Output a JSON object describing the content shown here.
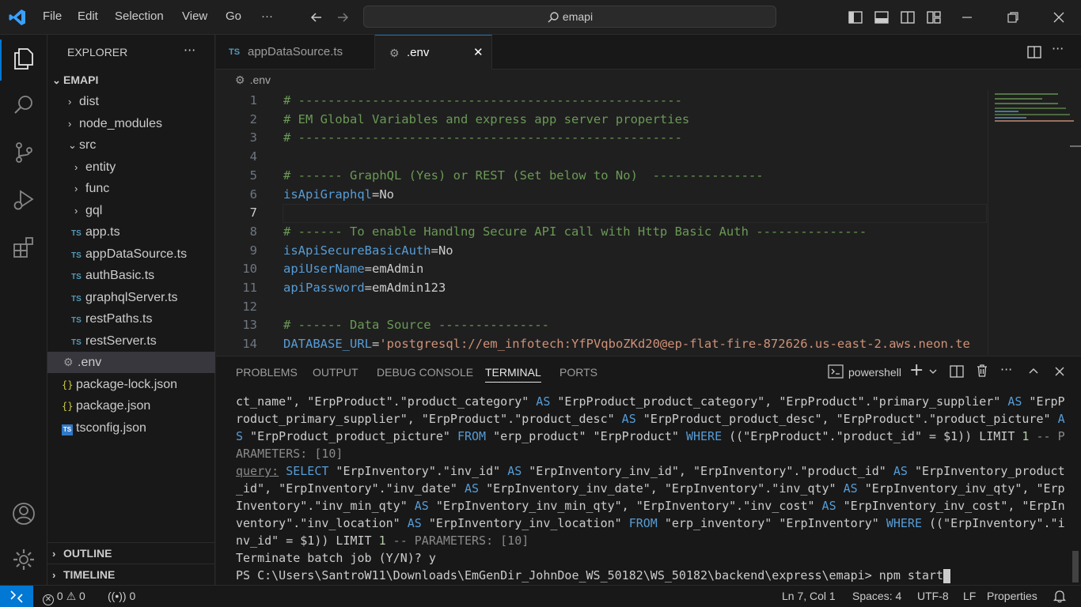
{
  "menu": {
    "file": "File",
    "edit": "Edit",
    "selection": "Selection",
    "view": "View",
    "go": "Go",
    "more": "···"
  },
  "search": {
    "text": "emapi"
  },
  "explorer": {
    "title": "EXPLORER",
    "more": "···",
    "root": "EMAPI",
    "items": [
      {
        "label": "dist"
      },
      {
        "label": "node_modules"
      },
      {
        "label": "src"
      },
      {
        "label": "entity"
      },
      {
        "label": "func"
      },
      {
        "label": "gql"
      },
      {
        "label": "app.ts"
      },
      {
        "label": "appDataSource.ts"
      },
      {
        "label": "authBasic.ts"
      },
      {
        "label": "graphqlServer.ts"
      },
      {
        "label": "restPaths.ts"
      },
      {
        "label": "restServer.ts"
      },
      {
        "label": ".env"
      },
      {
        "label": "package-lock.json"
      },
      {
        "label": "package.json"
      },
      {
        "label": "tsconfig.json"
      }
    ],
    "outline": "OUTLINE",
    "timeline": "TIMELINE",
    "ts_badge": "TS",
    "json_badge": "{}",
    "gear_glyph": "⚙"
  },
  "tabs": {
    "tab1": "appDataSource.ts",
    "tab2": ".env",
    "close": "✕"
  },
  "breadcrumb": {
    "file": ".env"
  },
  "editor": {
    "lines": [
      {
        "num": "1",
        "parts": [
          {
            "cls": "cmt",
            "text": "# ----------------------------------------------------"
          }
        ]
      },
      {
        "num": "2",
        "parts": [
          {
            "cls": "cmt",
            "text": "# EM Global Variables and express app server properties"
          }
        ]
      },
      {
        "num": "3",
        "parts": [
          {
            "cls": "cmt",
            "text": "# ----------------------------------------------------"
          }
        ]
      },
      {
        "num": "4",
        "parts": []
      },
      {
        "num": "5",
        "parts": [
          {
            "cls": "cmt",
            "text": "# ------ GraphQL (Yes) or REST (Set below to No)  ---------------"
          }
        ]
      },
      {
        "num": "6",
        "parts": [
          {
            "cls": "key",
            "text": "isApiGraphql"
          },
          {
            "cls": "val",
            "text": "=No"
          }
        ]
      },
      {
        "num": "7",
        "parts": []
      },
      {
        "num": "8",
        "parts": [
          {
            "cls": "cmt",
            "text": "# ------ To enable Handlng Secure API call with Http Basic Auth ---------------"
          }
        ]
      },
      {
        "num": "9",
        "parts": [
          {
            "cls": "key",
            "text": "isApiSecureBasicAuth"
          },
          {
            "cls": "val",
            "text": "=No"
          }
        ]
      },
      {
        "num": "10",
        "parts": [
          {
            "cls": "key",
            "text": "apiUserName"
          },
          {
            "cls": "val",
            "text": "=emAdmin"
          }
        ]
      },
      {
        "num": "11",
        "parts": [
          {
            "cls": "key",
            "text": "apiPassword"
          },
          {
            "cls": "val",
            "text": "=emAdmin123"
          }
        ]
      },
      {
        "num": "12",
        "parts": []
      },
      {
        "num": "13",
        "parts": [
          {
            "cls": "cmt",
            "text": "# ------ Data Source ---------------"
          }
        ]
      },
      {
        "num": "14",
        "parts": [
          {
            "cls": "key",
            "text": "DATABASE_URL"
          },
          {
            "cls": "val",
            "text": "="
          },
          {
            "cls": "str",
            "text": "'postgresql://em_infotech:YfPVqboZKd20@ep-flat-fire-872626.us-east-2.aws.neon.te"
          }
        ]
      }
    ]
  },
  "panel": {
    "tabs": [
      "PROBLEMS",
      "OUTPUT",
      "DEBUG CONSOLE",
      "TERMINAL",
      "PORTS"
    ],
    "shell": "powershell",
    "plus": "+",
    "terminal_lines": [
      [
        {
          "c": "",
          "t": "ct_name\", \"ErpProduct\".\"product_category\" "
        },
        {
          "c": "t-kw",
          "t": "AS"
        },
        {
          "c": "",
          "t": " \"ErpProduct_product_category\", \"ErpProduct\".\"primary_supplier\" "
        },
        {
          "c": "t-kw",
          "t": "AS"
        },
        {
          "c": "",
          "t": " \"ErpP"
        }
      ],
      [
        {
          "c": "",
          "t": "roduct_primary_supplier\", \"ErpProduct\".\"product_desc\" "
        },
        {
          "c": "t-kw",
          "t": "AS"
        },
        {
          "c": "",
          "t": " \"ErpProduct_product_desc\", \"ErpProduct\".\"product_picture\" "
        },
        {
          "c": "t-kw",
          "t": "A"
        }
      ],
      [
        {
          "c": "t-kw",
          "t": "S"
        },
        {
          "c": "",
          "t": " \"ErpProduct_product_picture\" "
        },
        {
          "c": "t-kw",
          "t": "FROM"
        },
        {
          "c": "",
          "t": " \"erp_product\" \"ErpProduct\" "
        },
        {
          "c": "t-kw",
          "t": "WHERE"
        },
        {
          "c": "",
          "t": " ((\"ErpProduct\".\"product_id\" = $1)) LIMIT "
        },
        {
          "c": "t-num",
          "t": "1"
        },
        {
          "c": "t-dim",
          "t": " -- P"
        }
      ],
      [
        {
          "c": "t-dim",
          "t": "ARAMETERS: [10]"
        }
      ],
      [
        {
          "c": "t-link",
          "t": "query:"
        },
        {
          "c": "",
          "t": " "
        },
        {
          "c": "t-kw",
          "t": "SELECT"
        },
        {
          "c": "",
          "t": " \"ErpInventory\".\"inv_id\" "
        },
        {
          "c": "t-kw",
          "t": "AS"
        },
        {
          "c": "",
          "t": " \"ErpInventory_inv_id\", \"ErpInventory\".\"product_id\" "
        },
        {
          "c": "t-kw",
          "t": "AS"
        },
        {
          "c": "",
          "t": " \"ErpInventory_product"
        }
      ],
      [
        {
          "c": "",
          "t": "_id\", \"ErpInventory\".\"inv_date\" "
        },
        {
          "c": "t-kw",
          "t": "AS"
        },
        {
          "c": "",
          "t": " \"ErpInventory_inv_date\", \"ErpInventory\".\"inv_qty\" "
        },
        {
          "c": "t-kw",
          "t": "AS"
        },
        {
          "c": "",
          "t": " \"ErpInventory_inv_qty\", \"Erp"
        }
      ],
      [
        {
          "c": "",
          "t": "Inventory\".\"inv_min_qty\" "
        },
        {
          "c": "t-kw",
          "t": "AS"
        },
        {
          "c": "",
          "t": " \"ErpInventory_inv_min_qty\", \"ErpInventory\".\"inv_cost\" "
        },
        {
          "c": "t-kw",
          "t": "AS"
        },
        {
          "c": "",
          "t": " \"ErpInventory_inv_cost\", \"ErpIn"
        }
      ],
      [
        {
          "c": "",
          "t": "ventory\".\"inv_location\" "
        },
        {
          "c": "t-kw",
          "t": "AS"
        },
        {
          "c": "",
          "t": " \"ErpInventory_inv_location\" "
        },
        {
          "c": "t-kw",
          "t": "FROM"
        },
        {
          "c": "",
          "t": " \"erp_inventory\" \"ErpInventory\" "
        },
        {
          "c": "t-kw",
          "t": "WHERE"
        },
        {
          "c": "",
          "t": " ((\"ErpInventory\".\"i"
        }
      ],
      [
        {
          "c": "",
          "t": "nv_id\" = $1)) LIMIT "
        },
        {
          "c": "t-num",
          "t": "1"
        },
        {
          "c": "t-dim",
          "t": " -- PARAMETERS: [10]"
        }
      ],
      [
        {
          "c": "",
          "t": "Terminate batch job (Y/N)? y"
        }
      ],
      [
        {
          "c": "",
          "t": "PS C:\\Users\\SantroW11\\Downloads\\EmGenDir_JohnDoe_WS_50182\\WS_50182\\backend\\express\\emapi> "
        },
        {
          "c": "prompt-cmd",
          "t": "npm start"
        }
      ]
    ]
  },
  "status": {
    "errors": "0",
    "warnings": "0",
    "ports": "0",
    "position": "Ln 7, Col 1",
    "spaces": "Spaces: 4",
    "encoding": "UTF-8",
    "eol": "LF",
    "language": "Properties"
  },
  "colors": {
    "accent": "#0078d4",
    "comment": "#6a9955",
    "keyword": "#569cd6",
    "string": "#ce9178"
  }
}
